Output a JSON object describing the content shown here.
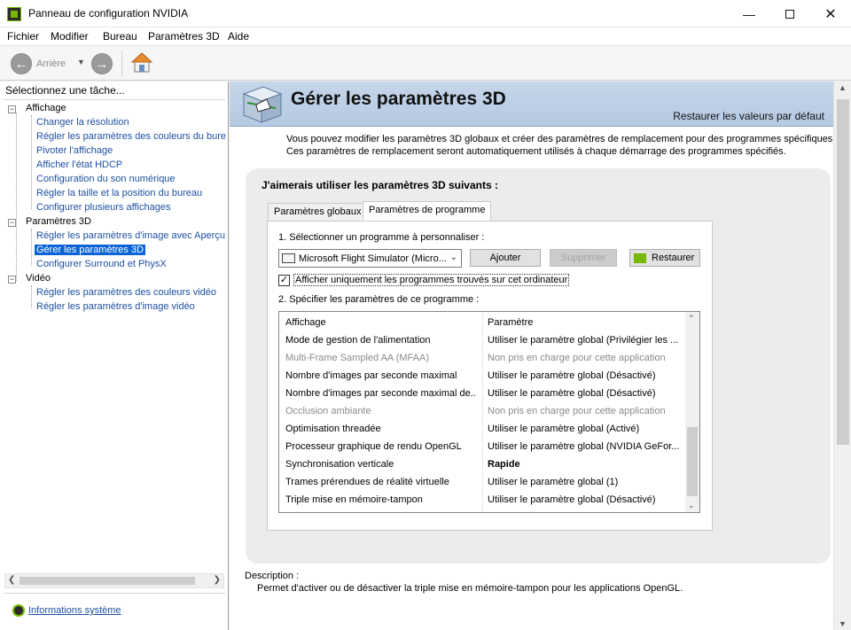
{
  "window": {
    "title": "Panneau de configuration NVIDIA",
    "controls": [
      "minimize",
      "maximize",
      "close"
    ]
  },
  "menu": [
    "Fichier",
    "Modifier",
    "Bureau",
    "Paramètres 3D",
    "Aide"
  ],
  "toolbar": {
    "back_label": "Arrière"
  },
  "left_pane": {
    "header": "Sélectionnez une tâche...",
    "tree": [
      {
        "label": "Affichage",
        "children": [
          "Changer la résolution",
          "Régler les paramètres des couleurs du bure",
          "Pivoter l'affichage",
          "Afficher l'état HDCP",
          "Configuration du son numérique",
          "Régler la taille et la position du bureau",
          "Configurer plusieurs affichages"
        ]
      },
      {
        "label": "Paramètres 3D",
        "children": [
          "Régler les paramètres d'image avec Aperçu",
          "Gérer les paramètres 3D",
          "Configurer Surround et PhysX"
        ]
      },
      {
        "label": "Vidéo",
        "children": [
          "Régler les paramètres des couleurs vidéo",
          "Régler les paramètres d'image vidéo"
        ]
      }
    ],
    "selected": "Gérer les paramètres 3D",
    "system_info_link": "Informations système"
  },
  "main": {
    "title": "Gérer les paramètres 3D",
    "restore_defaults": "Restaurer les valeurs par défaut",
    "intro": "Vous pouvez modifier les paramètres 3D globaux et créer des paramètres de remplacement pour des programmes spécifiques. Ces paramètres de remplacement seront automatiquement utilisés à chaque démarrage des programmes spécifiés.",
    "panel_heading": "J'aimerais utiliser les paramètres 3D suivants :",
    "tabs": [
      "Paramètres globaux",
      "Paramètres de programme"
    ],
    "active_tab": "Paramètres de programme",
    "step1_label": "1. Sélectionner un programme à personnaliser :",
    "program_selected": "Microsoft Flight Simulator (Micro...",
    "add_button": "Ajouter",
    "remove_button": "Supprimer",
    "restore_button": "Restaurer",
    "checkbox_label": "Afficher uniquement les programmes trouvés sur cet ordinateur",
    "checkbox_checked": true,
    "step2_label": "2. Spécifier les paramètres de ce programme :",
    "grid": {
      "headers": [
        "Affichage",
        "Paramètre"
      ],
      "rows": [
        {
          "feature": "Mode de gestion de l'alimentation",
          "setting": "Utiliser le paramètre global (Privilégier les ...",
          "disabled": false,
          "bold": false
        },
        {
          "feature": "Multi-Frame Sampled AA (MFAA)",
          "setting": "Non pris en charge pour cette application",
          "disabled": true,
          "bold": false
        },
        {
          "feature": "Nombre d'images par seconde maximal",
          "setting": "Utiliser le paramètre global (Désactivé)",
          "disabled": false,
          "bold": false
        },
        {
          "feature": "Nombre d'images par seconde maximal de...",
          "setting": "Utiliser le paramètre global (Désactivé)",
          "disabled": false,
          "bold": false
        },
        {
          "feature": "Occlusion ambiante",
          "setting": "Non pris en charge pour cette application",
          "disabled": true,
          "bold": false
        },
        {
          "feature": "Optimisation threadée",
          "setting": "Utiliser le paramètre global (Activé)",
          "disabled": false,
          "bold": false
        },
        {
          "feature": "Processeur graphique de rendu OpenGL",
          "setting": "Utiliser le paramètre global (NVIDIA GeFor...",
          "disabled": false,
          "bold": false
        },
        {
          "feature": "Synchronisation verticale",
          "setting": "Rapide",
          "disabled": false,
          "bold": true
        },
        {
          "feature": "Trames prérendues de réalité virtuelle",
          "setting": "Utiliser le paramètre global (1)",
          "disabled": false,
          "bold": false
        },
        {
          "feature": "Triple mise en mémoire-tampon",
          "setting": "Utiliser le paramètre global (Désactivé)",
          "disabled": false,
          "bold": false
        }
      ]
    },
    "description_label": "Description :",
    "description_text": "Permet d'activer ou de désactiver la triple mise en mémoire-tampon pour les applications OpenGL."
  },
  "colors": {
    "nvidia_green": "#76b900",
    "link_blue": "#1e50a2",
    "selection_blue": "#0a64d6",
    "banner_blue": "#b9cce4"
  }
}
